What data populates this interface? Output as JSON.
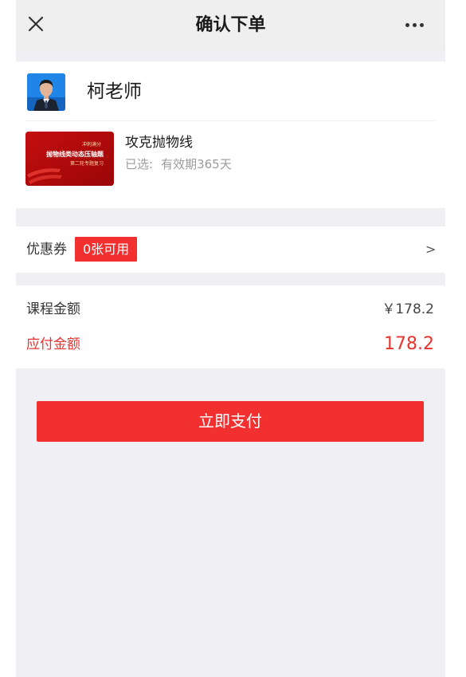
{
  "header": {
    "title": "确认下单",
    "close_icon": "close-icon",
    "more_icon": "more-dots-icon"
  },
  "teacher": {
    "name": "柯老师"
  },
  "course": {
    "thumbnail": {
      "line1": "冲刺满分",
      "line2": "抛物线类动态压轴题",
      "line3": "第二轮专题复习"
    },
    "title": "攻克抛物线",
    "selected_label": "已选:",
    "selected_value": "有效期365天"
  },
  "coupon": {
    "label": "优惠券",
    "badge": "0张可用",
    "arrow": ">"
  },
  "amount": {
    "course_label": "课程金额",
    "course_value": "￥178.2",
    "payable_label": "应付金额",
    "payable_value": "178.2"
  },
  "actions": {
    "pay_label": "立即支付"
  },
  "colors": {
    "accent": "#f23030",
    "payable_text": "#e8332f",
    "page_bg": "#f0eff4",
    "header_bg": "#efefef"
  }
}
